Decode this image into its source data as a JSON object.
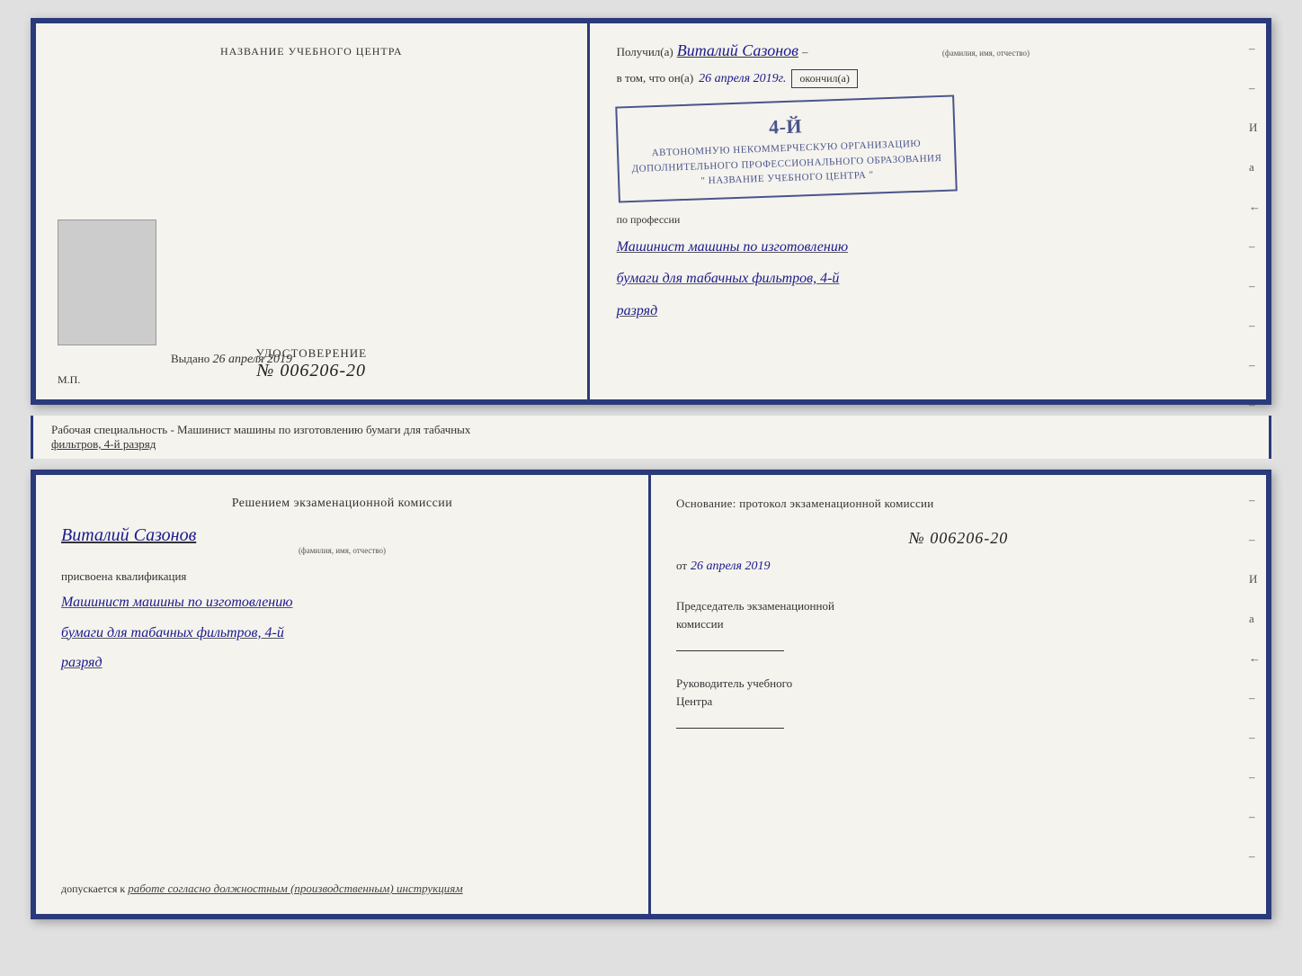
{
  "top_cert": {
    "left": {
      "title": "НАЗВАНИЕ УЧЕБНОГО ЦЕНТРА",
      "udostoverenie_label": "УДОСТОВЕРЕНИЕ",
      "number": "№ 006206-20",
      "vydano_prefix": "Выдано",
      "vydano_date": "26 апреля 2019",
      "mp": "М.П."
    },
    "right": {
      "poluchil_prefix": "Получил(а)",
      "fio": "Виталий Сазонов",
      "fio_sub": "(фамилия, имя, отчество)",
      "dash": "–",
      "vtom_prefix": "в том, что он(а)",
      "vtom_date": "26 апреля 2019г.",
      "okonchil": "окончил(а)",
      "stamp_line1": "4-й",
      "stamp_line2": "АВТОНОМНУЮ НЕКОММЕРЧЕСКУЮ ОРГАНИЗАЦИЮ",
      "stamp_line3": "ДОПОЛНИТЕЛЬНОГО ПРОФЕССИОНАЛЬНОГО ОБРАЗОВАНИЯ",
      "stamp_line4": "\" НАЗВАНИЕ УЧЕБНОГО ЦЕНТРА \"",
      "i_label": "И",
      "a_label": "а",
      "arrow_label": "←",
      "po_professii": "по профессии",
      "profession1": "Машинист машины по изготовлению",
      "profession2": "бумаги для табачных фильтров, 4-й",
      "profession3": "разряд"
    }
  },
  "annotation": {
    "text": "Рабочая специальность - Машинист машины по изготовлению бумаги для табачных",
    "text2": "фильтров, 4-й разряд"
  },
  "bottom_cert": {
    "left": {
      "resheniyem": "Решением экзаменационной комиссии",
      "fio": "Виталий Сазонов",
      "fio_sub": "(фамилия, имя, отчество)",
      "prisvoyena": "присвоена квалификация",
      "qual1": "Машинист машины по изготовлению",
      "qual2": "бумаги для табачных фильтров, 4-й",
      "qual3": "разряд",
      "dopusk_prefix": "допускается к",
      "dopusk_text": "работе согласно должностным (производственным) инструкциям"
    },
    "right": {
      "osnovanie": "Основание: протокол экзаменационной комиссии",
      "number": "№ 006206-20",
      "ot_prefix": "от",
      "ot_date": "26 апреля 2019",
      "predsedatel1": "Председатель экзаменационной",
      "predsedatel2": "комиссии",
      "rukovoditel1": "Руководитель учебного",
      "rukovoditel2": "Центра",
      "i_label": "И",
      "a_label": "а",
      "arrow_label": "←"
    }
  }
}
